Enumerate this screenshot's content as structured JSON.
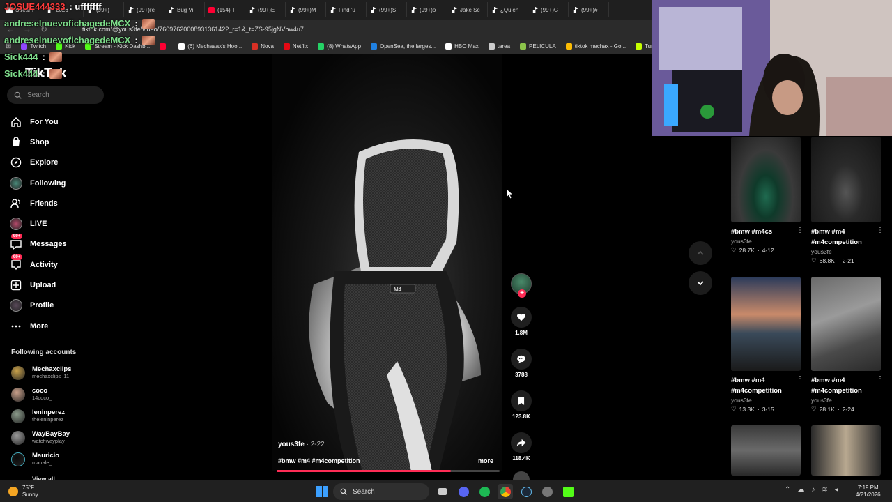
{
  "browser": {
    "tabs": [
      {
        "label": "Stream",
        "icon": "stream"
      },
      {
        "label": "2026",
        "icon": "tiktok"
      },
      {
        "label": "(99+)",
        "icon": "tiktok"
      },
      {
        "label": "(99+)re",
        "icon": "tiktok"
      },
      {
        "label": "Bug Vi",
        "icon": "tiktok"
      },
      {
        "label": "(154) T",
        "icon": "youtube"
      },
      {
        "label": "(99+)E",
        "icon": "tiktok"
      },
      {
        "label": "(99+)M",
        "icon": "tiktok"
      },
      {
        "label": "Find 'u",
        "icon": "tiktok"
      },
      {
        "label": "(99+)S",
        "icon": "tiktok"
      },
      {
        "label": "(99+)o",
        "icon": "tiktok"
      },
      {
        "label": "Jake Sc",
        "icon": "tiktok"
      },
      {
        "label": "¿Quién",
        "icon": "tiktok"
      },
      {
        "label": "(99+)G",
        "icon": "tiktok"
      },
      {
        "label": "(99+)#",
        "icon": "tiktok"
      }
    ],
    "url": "tiktok.com/@yous3fe/video/7609762000893136142?_r=1&_t=ZS-95jgNVbw4u7",
    "bookmarks": [
      {
        "label": "Twitch",
        "color": "#9146ff"
      },
      {
        "label": "Kick",
        "color": "#53fc18"
      },
      {
        "label": "Stream - Kick Dashb...",
        "color": "#53fc18"
      },
      {
        "label": "",
        "color": "#ff0033"
      },
      {
        "label": "(6) Mechaaax's Hoo...",
        "color": "#ffffff"
      },
      {
        "label": "Nova",
        "color": "#d93025"
      },
      {
        "label": "Netflix",
        "color": "#e50914"
      },
      {
        "label": "(8) WhatsApp",
        "color": "#25d366"
      },
      {
        "label": "OpenSea, the larges...",
        "color": "#2081e2"
      },
      {
        "label": "HBO Max",
        "color": "#ffffff"
      },
      {
        "label": "tarea",
        "color": "#cccccc"
      },
      {
        "label": "PELICULA",
        "color": "#8bc34a"
      },
      {
        "label": "tiktok mechax - Go...",
        "color": "#fbbc04"
      },
      {
        "label": "Turn You",
        "color": "#c6ff00"
      }
    ]
  },
  "chat": [
    {
      "name": "JOSUE444333",
      "message": ": ufffffff",
      "color": "red"
    },
    {
      "name": "andreselnuevofichagedeMCX",
      "message": ":",
      "color": "green"
    },
    {
      "name": "andreselnuevofichagedeMCX",
      "message": ":",
      "color": "green"
    },
    {
      "name": "Sick444",
      "message": ":",
      "color": "green"
    },
    {
      "name": "Sick444",
      "message": ":",
      "color": "green"
    }
  ],
  "tiktok": {
    "logo": "TikTok",
    "search_placeholder": "Search",
    "nav": [
      {
        "label": "For You",
        "icon": "home-icon"
      },
      {
        "label": "Shop",
        "icon": "shop-icon"
      },
      {
        "label": "Explore",
        "icon": "compass-icon"
      },
      {
        "label": "Following",
        "icon": "following-avatar"
      },
      {
        "label": "Friends",
        "icon": "friends-icon"
      },
      {
        "label": "LIVE",
        "icon": "live-avatar"
      },
      {
        "label": "Messages",
        "icon": "messages-icon",
        "badge": "99+"
      },
      {
        "label": "Activity",
        "icon": "activity-icon",
        "badge": "99+"
      },
      {
        "label": "Upload",
        "icon": "upload-icon"
      },
      {
        "label": "Profile",
        "icon": "profile-avatar"
      },
      {
        "label": "More",
        "icon": "more-icon"
      }
    ],
    "following_title": "Following accounts",
    "following": [
      {
        "name": "Mechaxclips",
        "handle": "mechaxclips_11",
        "color": "#c9a14a"
      },
      {
        "name": "coco",
        "handle": "14coco_",
        "color": "#c9a08a"
      },
      {
        "name": "leninperez",
        "handle": "theleninperez",
        "color": "#8a9a8a"
      },
      {
        "name": "WayBayBay",
        "handle": "watchwayplay",
        "color": "#9a9a9a"
      },
      {
        "name": "Mauricio",
        "handle": "mauale_",
        "color": "#0a0a0a"
      }
    ],
    "view_all": "View all",
    "video": {
      "author": "yous3fe",
      "date": "2-22",
      "caption": "#bmw #m4 #m4competition",
      "more": "more",
      "progress": 0.78
    },
    "actions": {
      "likes": "1.8M",
      "comments": "3788",
      "saves": "123.8K",
      "shares": "118.4K"
    },
    "related": [
      {
        "title": "#bmw #m4cs",
        "user": "yous3fe",
        "likes": "28.7K",
        "date": "4-12"
      },
      {
        "title": "#bmw #m4 #m4competition",
        "user": "yous3fe",
        "likes": "68.8K",
        "date": "2-21"
      },
      {
        "title": "#bmw #m4 #m4competition",
        "user": "yous3fe",
        "likes": "13.3K",
        "date": "3-15"
      },
      {
        "title": "#bmw #m4 #m4competition",
        "user": "yous3fe",
        "likes": "28.1K",
        "date": "2-24"
      }
    ]
  },
  "taskbar": {
    "temperature": "75°F",
    "condition": "Sunny",
    "search": "Search",
    "time": "7:19 PM",
    "date": "4/21/2026"
  }
}
